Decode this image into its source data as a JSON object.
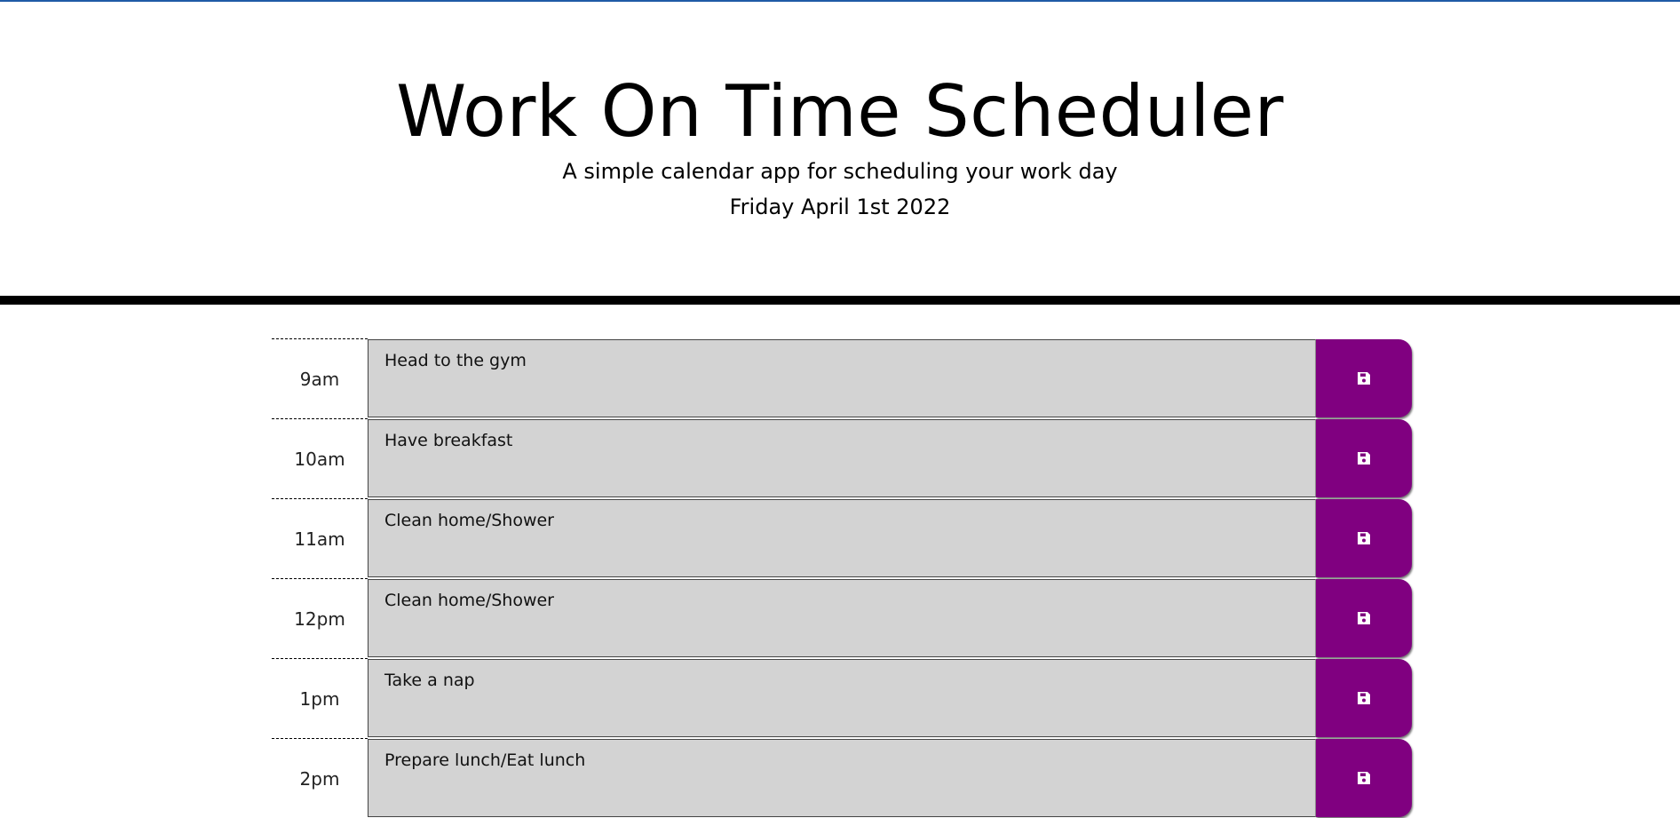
{
  "header": {
    "title": "Work On Time Scheduler",
    "subtitle": "A simple calendar app for scheduling your work day",
    "current_day": "Friday April 1st 2022"
  },
  "colors": {
    "accent_top": "#1f5aa6",
    "past_block": "#d3d3d3",
    "save_button": "#800080"
  },
  "save_icon": "floppy-disk-icon",
  "time_blocks": [
    {
      "hour": "9am",
      "text": "Head to the gym"
    },
    {
      "hour": "10am",
      "text": "Have breakfast"
    },
    {
      "hour": "11am",
      "text": "Clean home/Shower"
    },
    {
      "hour": "12pm",
      "text": "Clean home/Shower"
    },
    {
      "hour": "1pm",
      "text": "Take a nap"
    },
    {
      "hour": "2pm",
      "text": "Prepare lunch/Eat lunch"
    }
  ]
}
